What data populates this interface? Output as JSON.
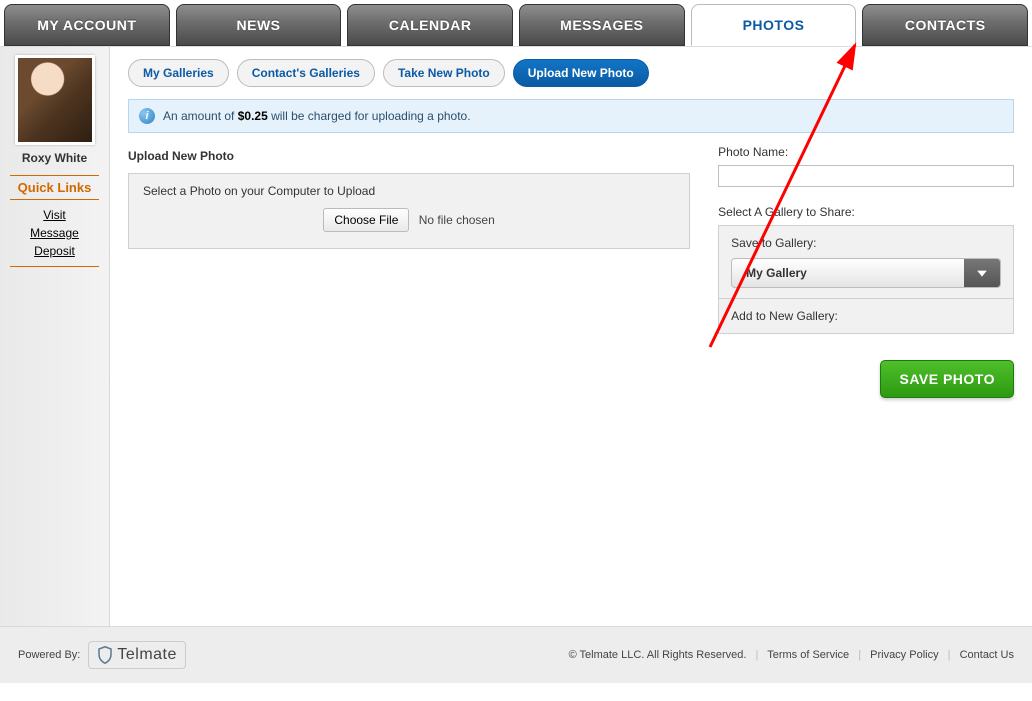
{
  "nav": {
    "tabs": [
      "MY ACCOUNT",
      "NEWS",
      "CALENDAR",
      "MESSAGES",
      "PHOTOS",
      "CONTACTS"
    ],
    "activeIndex": 4
  },
  "sidebar": {
    "userName": "Roxy White",
    "quickLinksTitle": "Quick Links",
    "links": [
      "Visit",
      "Message",
      "Deposit"
    ]
  },
  "subtabs": {
    "items": [
      "My Galleries",
      "Contact's Galleries",
      "Take New Photo",
      "Upload New Photo"
    ],
    "activeIndex": 3
  },
  "info": {
    "prefix": "An amount of ",
    "amount": "$0.25",
    "suffix": " will be charged for uploading a photo."
  },
  "upload": {
    "title": "Upload New Photo",
    "hint": "Select a Photo on your Computer to Upload",
    "chooseLabel": "Choose File",
    "fileStatus": "No file chosen"
  },
  "photoName": {
    "label": "Photo Name:",
    "value": ""
  },
  "gallerySelect": {
    "heading": "Select A Gallery to Share:",
    "saveLabel": "Save to Gallery:",
    "selected": "My Gallery",
    "addLabel": "Add to New Gallery:"
  },
  "saveButton": "SAVE PHOTO",
  "footer": {
    "poweredBy": "Powered By:",
    "brand": "Telmate",
    "copyright": "© Telmate LLC. All Rights Reserved.",
    "links": [
      "Terms of Service",
      "Privacy Policy",
      "Contact Us"
    ]
  }
}
